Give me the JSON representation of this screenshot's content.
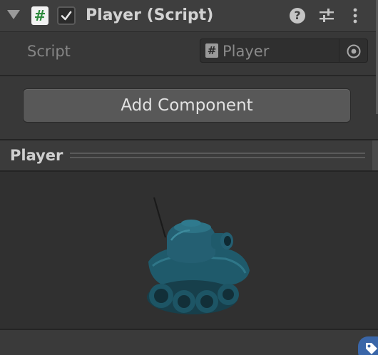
{
  "component": {
    "title": "Player (Script)",
    "enabled": true,
    "icons": {
      "script": "#",
      "help": "?",
      "presets": "sliders-icon",
      "menu": "kebab-icon"
    }
  },
  "script_field": {
    "label": "Script",
    "value": "Player",
    "icon": "#"
  },
  "add_component": {
    "label": "Add Component"
  },
  "preview": {
    "title": "Player"
  },
  "colors": {
    "background": "#383838",
    "header": "#3e3e3e",
    "button": "#585858",
    "tank": "#1f5a6b",
    "badge": "#3a66a8"
  }
}
